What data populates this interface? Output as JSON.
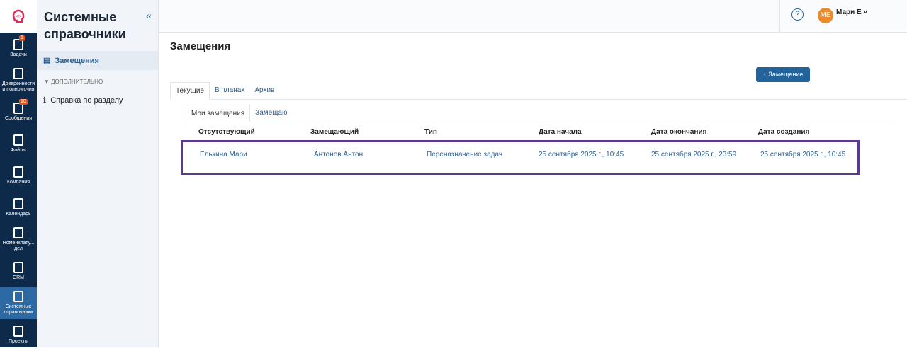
{
  "rail": [
    {
      "label": "Задачи",
      "badge": "1"
    },
    {
      "label": "Доверенности и полномочия"
    },
    {
      "label": "Сообщения",
      "badge": "10"
    },
    {
      "label": "Файлы"
    },
    {
      "label": "Компания"
    },
    {
      "label": "Календарь"
    },
    {
      "label": "Номенклату... дел"
    },
    {
      "label": "CRM"
    },
    {
      "label": "Системные справочники",
      "active": true
    },
    {
      "label": "Проекты"
    }
  ],
  "sidebar": {
    "title": "Системные справочники",
    "collapse": "«",
    "item": "Замещения",
    "section": "ДОПОЛНИТЕЛЬНО",
    "help": "Справка по разделу"
  },
  "header": {
    "help": "?",
    "initials": "МЕ",
    "user": "Мари Е ˅"
  },
  "page": {
    "title": "Замещения",
    "add": "+ Замещение",
    "tabs": [
      "Текущие",
      "В планах",
      "Архив"
    ],
    "subtabs": [
      "Мои замещения",
      "Замещаю"
    ]
  },
  "table": {
    "headers": [
      "Отсутствующий",
      "Замещающий",
      "Тип",
      "Дата начала",
      "Дата окончания",
      "Дата создания"
    ],
    "row": [
      "Елькина Мари",
      "Антонов Антон",
      "Переназначение задач",
      "25 сентября 2025 г., 10:45",
      "25 сентября 2025 г., 23:59",
      "25 сентября 2025 г., 10:45"
    ]
  }
}
